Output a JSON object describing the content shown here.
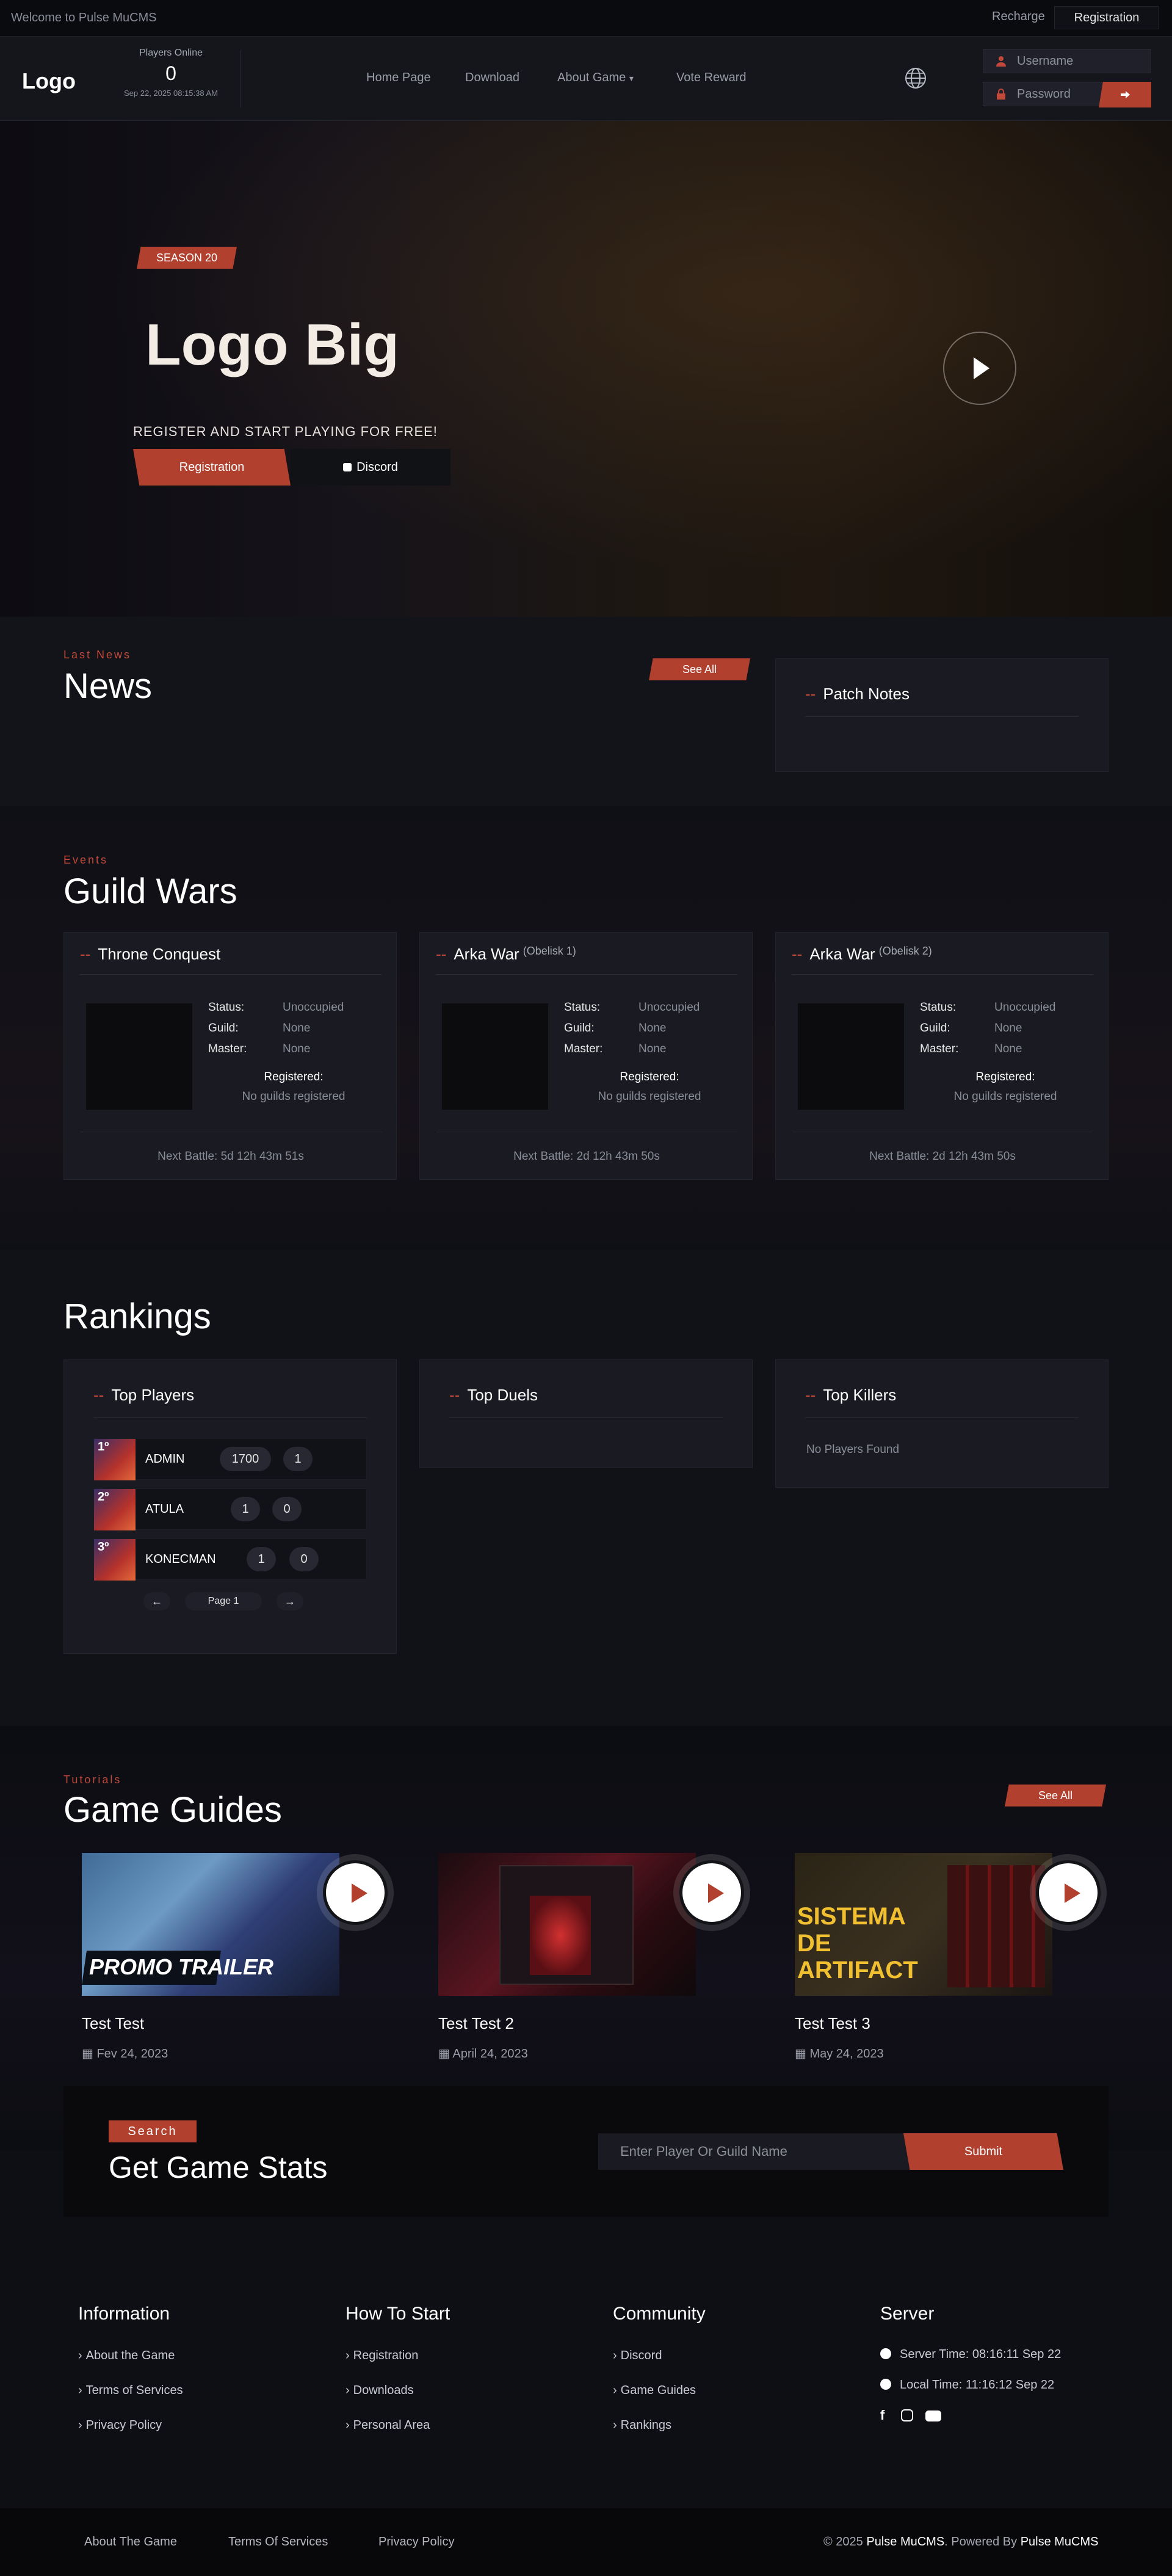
{
  "topbar": {
    "welcome": "Welcome to Pulse MuCMS",
    "recharge": "Recharge",
    "registration": "Registration"
  },
  "header": {
    "logo": "Logo",
    "online_label": "Players Online",
    "online_count": "0",
    "online_time": "Sep 22, 2025 08:15:38 AM",
    "nav": [
      "Home Page",
      "Download",
      "About Game",
      "Vote Reward"
    ],
    "username_placeholder": "Username",
    "password_placeholder": "Password"
  },
  "hero": {
    "season": "SEASON 20",
    "title": "Logo Big",
    "subtitle": "REGISTER AND START PLAYING FOR FREE!",
    "register_btn": "Registration",
    "discord_btn": "Discord"
  },
  "news": {
    "kicker": "Last News",
    "title": "News",
    "see_all": "See All",
    "patch_title": "Patch Notes"
  },
  "guild_wars": {
    "kicker": "Events",
    "title": "Guild Wars",
    "labels": {
      "status": "Status:",
      "guild": "Guild:",
      "master": "Master:",
      "registered": "Registered:"
    },
    "cards": [
      {
        "name": "Throne Conquest",
        "sub": "",
        "status": "Unoccupied",
        "guild": "None",
        "master": "None",
        "registered": "No guilds registered",
        "next_battle": "Next Battle: 5d 12h 43m 51s"
      },
      {
        "name": "Arka War",
        "sub": "(Obelisk 1)",
        "status": "Unoccupied",
        "guild": "None",
        "master": "None",
        "registered": "No guilds registered",
        "next_battle": "Next Battle: 2d 12h 43m 50s"
      },
      {
        "name": "Arka War",
        "sub": "(Obelisk 2)",
        "status": "Unoccupied",
        "guild": "None",
        "master": "None",
        "registered": "No guilds registered",
        "next_battle": "Next Battle: 2d 12h 43m 50s"
      }
    ]
  },
  "rankings": {
    "title": "Rankings",
    "top_players": {
      "title": "Top Players",
      "rows": [
        {
          "rank": "1º",
          "name": "ADMIN",
          "a": "1700",
          "b": "1"
        },
        {
          "rank": "2º",
          "name": "ATULA",
          "a": "1",
          "b": "0"
        },
        {
          "rank": "3º",
          "name": "KONECMAN",
          "a": "1",
          "b": "0"
        }
      ],
      "page": "Page 1"
    },
    "top_duels": {
      "title": "Top Duels"
    },
    "top_killers": {
      "title": "Top Killers",
      "empty": "No Players Found"
    }
  },
  "guides": {
    "kicker": "Tutorials",
    "title": "Game Guides",
    "see_all": "See All",
    "items": [
      {
        "title": "Test Test",
        "date": "Fev 24, 2023",
        "img_text": "PROMO TRAILER"
      },
      {
        "title": "Test Test 2",
        "date": "April 24, 2023",
        "img_text": ""
      },
      {
        "title": "Test Test 3",
        "date": "May 24, 2023",
        "img_text": "SISTEMA DE ARTIFACT"
      }
    ]
  },
  "search": {
    "tag": "Search",
    "title": "Get Game Stats",
    "placeholder": "Enter Player Or Guild Name",
    "submit": "Submit"
  },
  "footer": {
    "info": {
      "title": "Information",
      "links": [
        "About the Game",
        "Terms of Services",
        "Privacy Policy"
      ]
    },
    "start": {
      "title": "How To Start",
      "links": [
        "Registration",
        "Downloads",
        "Personal Area"
      ]
    },
    "community": {
      "title": "Community",
      "links": [
        "Discord",
        "Game Guides",
        "Rankings"
      ]
    },
    "server": {
      "title": "Server",
      "server_time": "Server Time: 08:16:11 Sep 22",
      "local_time": "Local Time: 11:16:12 Sep 22"
    }
  },
  "bottom": {
    "links": [
      "About The Game",
      "Terms Of Services",
      "Privacy Policy"
    ],
    "copy_prefix": "© 2025",
    "brand": "Pulse MuCMS",
    "powered": ". Powered By",
    "brand2": "Pulse MuCMS"
  },
  "colors": {
    "accent": "#b1402f",
    "bg": "#0e0f14",
    "panel": "#1a1b22"
  }
}
